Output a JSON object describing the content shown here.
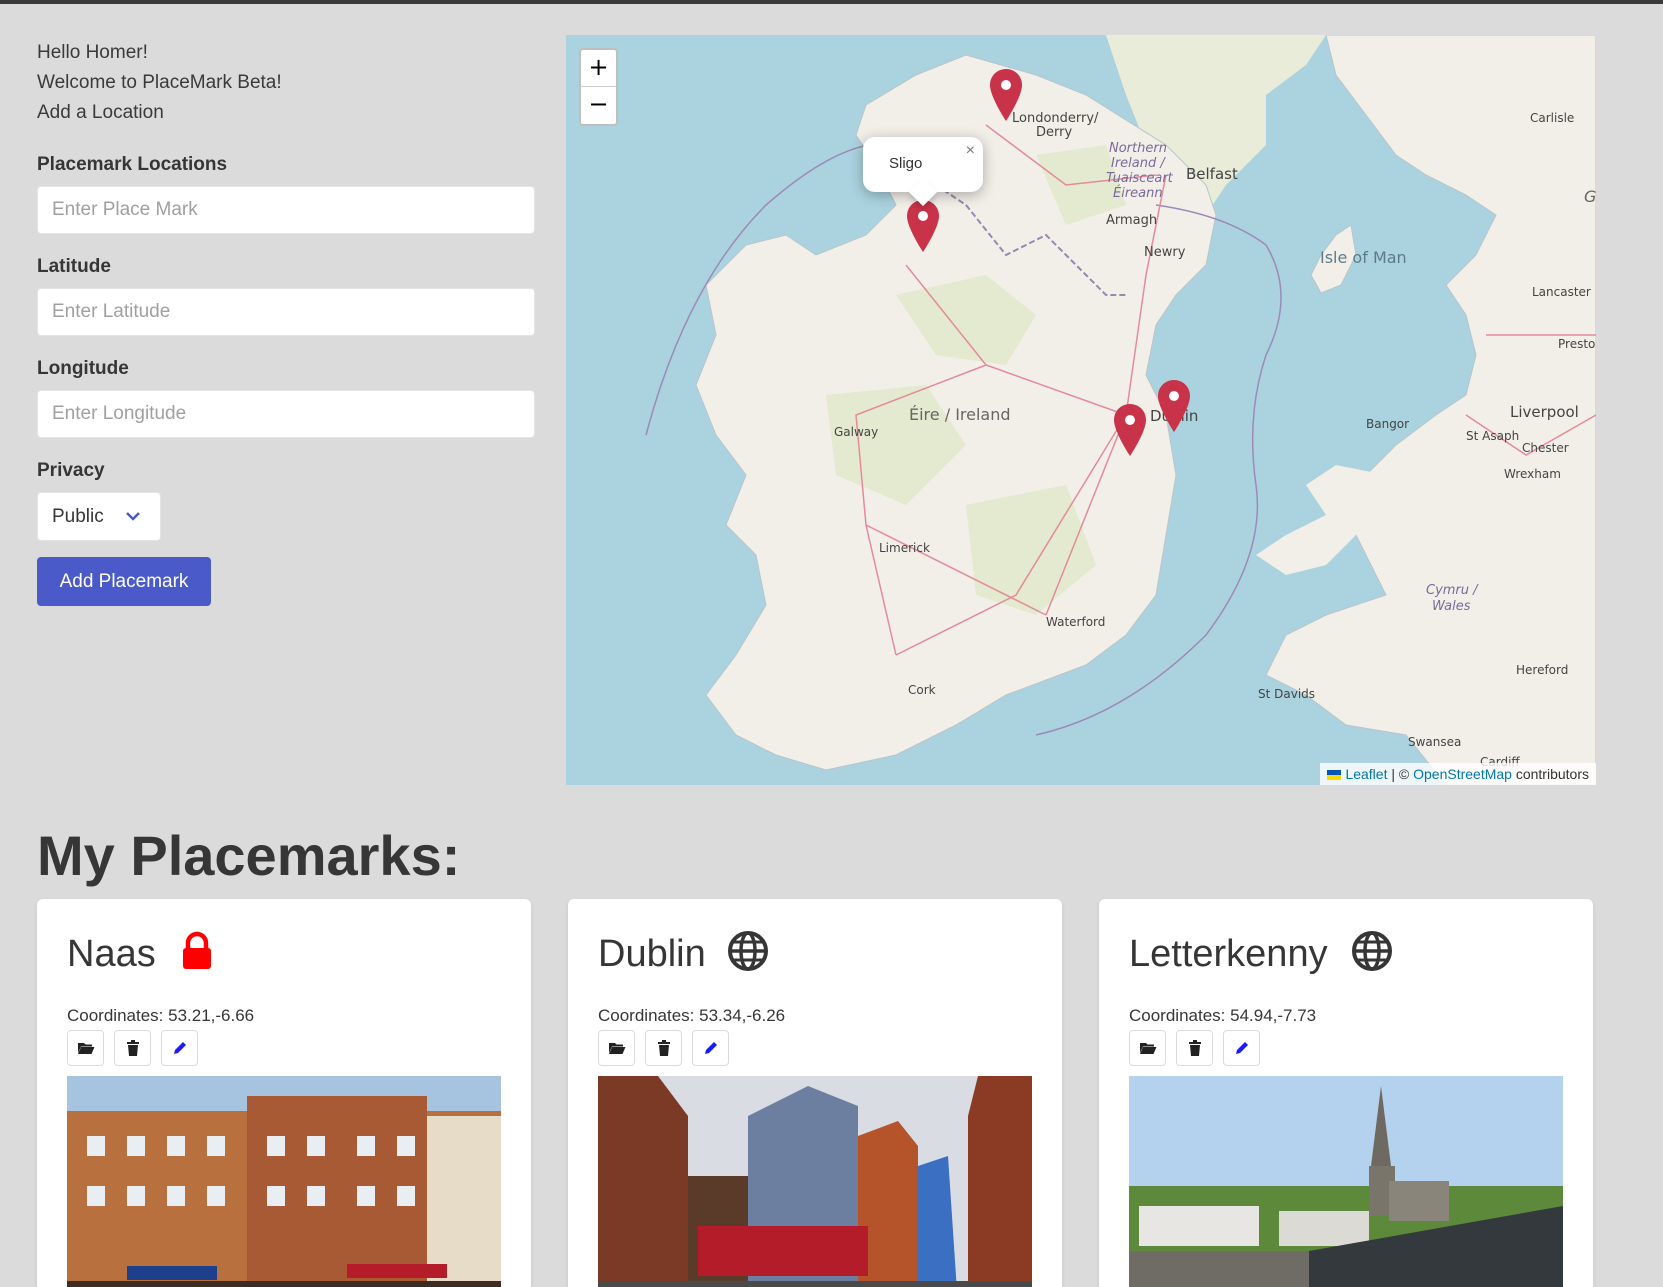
{
  "greeting": {
    "hello": "Hello Homer!",
    "welcome": "Welcome to PlaceMark Beta!",
    "add_location": "Add a Location"
  },
  "form": {
    "name_label": "Placemark Locations",
    "name_placeholder": "Enter Place Mark",
    "lat_label": "Latitude",
    "lat_placeholder": "Enter Latitude",
    "lng_label": "Longitude",
    "lng_placeholder": "Enter Longitude",
    "privacy_label": "Privacy",
    "privacy_value": "Public",
    "submit_label": "Add Placemark"
  },
  "map": {
    "zoom_in": "+",
    "zoom_out": "−",
    "popup_text": "Sligo",
    "popup_close": "×",
    "attribution": {
      "leaflet": "Leaflet",
      "separator": " | © ",
      "osm": "OpenStreetMap",
      "suffix": " contributors"
    },
    "labels": {
      "londonderry": "Londonderry/",
      "derry": "Derry",
      "northern_ireland_1": "Northern",
      "northern_ireland_2": "Ireland /",
      "northern_ireland_3": "Tuaisceart",
      "northern_ireland_4": "Éireann",
      "belfast": "Belfast",
      "armagh": "Armagh",
      "newry": "Newry",
      "isle_of_man": "Isle of Man",
      "carlisle": "Carlisle",
      "lancaster": "Lancaster",
      "preston": "Preston",
      "liverpool": "Liverpool",
      "bangor": "Bangor",
      "st_asaph": "St Asaph",
      "chester": "Chester",
      "wrexham": "Wrexham",
      "ireland": "Éire / Ireland",
      "galway": "Galway",
      "dublin": "Dublin",
      "limerick": "Limerick",
      "waterford": "Waterford",
      "cork": "Cork",
      "cymru_1": "Cymru /",
      "cymru_2": "Wales",
      "hereford": "Hereford",
      "st_davids": "St Davids",
      "swansea": "Swansea",
      "cardiff": "Cardiff",
      "g": "G"
    },
    "marker_color": "#c9334a"
  },
  "placemarks_heading": "My Placemarks:",
  "placemarks": [
    {
      "name": "Naas",
      "coordinates": "Coordinates: 53.21,-6.66",
      "privacy_icon": "lock-icon",
      "privacy_color": "#ff0000"
    },
    {
      "name": "Dublin",
      "coordinates": "Coordinates: 53.34,-6.26",
      "privacy_icon": "globe-icon",
      "privacy_color": "#363636"
    },
    {
      "name": "Letterkenny",
      "coordinates": "Coordinates: 54.94,-7.73",
      "privacy_icon": "globe-icon",
      "privacy_color": "#363636"
    }
  ],
  "colors": {
    "page_bg": "#dbdbdb",
    "button_primary": "#4a5ac8",
    "map_sea": "#aad3df",
    "map_land": "#f2efe9"
  }
}
